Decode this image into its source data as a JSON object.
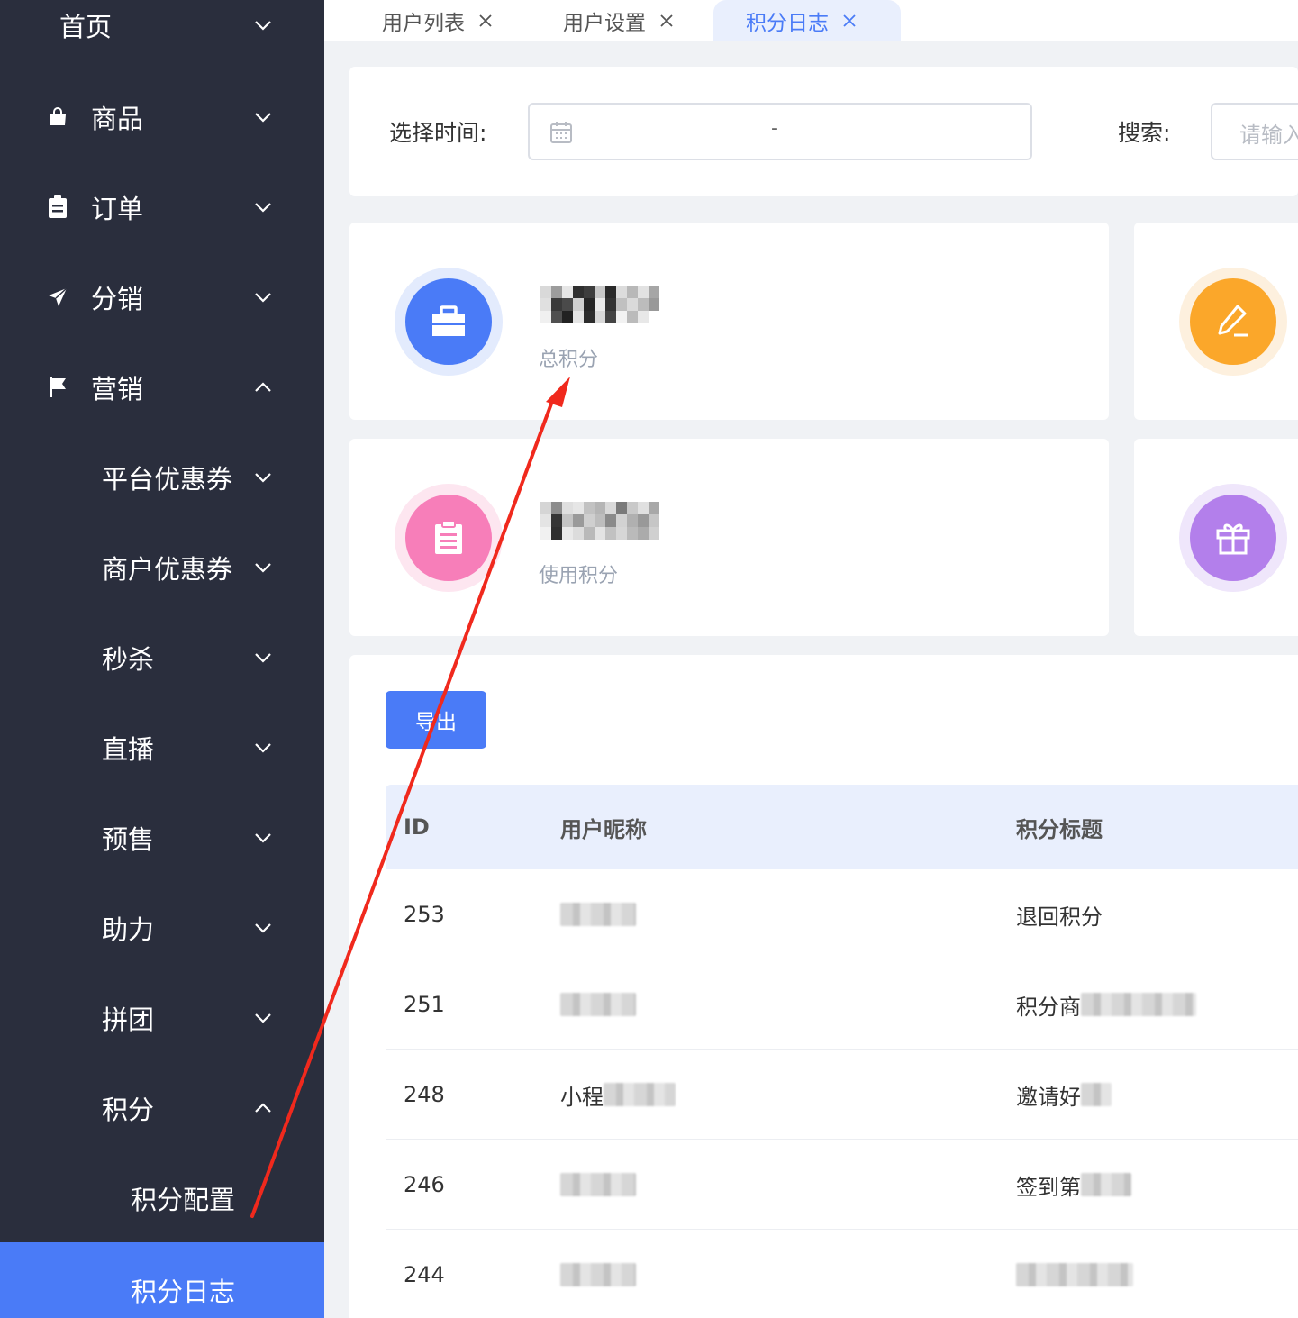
{
  "sidebar": {
    "items": [
      {
        "label": "首页",
        "icon": "none",
        "arrow": "chevron-down"
      },
      {
        "label": "商品",
        "icon": "shopping-bag-icon",
        "arrow": "chevron-down"
      },
      {
        "label": "订单",
        "icon": "clipboard-icon",
        "arrow": "chevron-down"
      },
      {
        "label": "分销",
        "icon": "paper-plane-icon",
        "arrow": "chevron-down"
      },
      {
        "label": "营销",
        "icon": "flag-icon",
        "arrow": "chevron-up"
      },
      {
        "label": "平台优惠券",
        "arrow": "chevron-down"
      },
      {
        "label": "商户优惠券",
        "arrow": "chevron-down"
      },
      {
        "label": "秒杀",
        "arrow": "chevron-down"
      },
      {
        "label": "直播",
        "arrow": "chevron-down"
      },
      {
        "label": "预售",
        "arrow": "chevron-down"
      },
      {
        "label": "助力",
        "arrow": "chevron-down"
      },
      {
        "label": "拼团",
        "arrow": "chevron-down"
      },
      {
        "label": "积分",
        "arrow": "chevron-up"
      },
      {
        "label": "积分配置"
      },
      {
        "label": "积分日志",
        "active": true
      }
    ]
  },
  "tabs": [
    {
      "label": "用户列表",
      "active": false
    },
    {
      "label": "用户设置",
      "active": false
    },
    {
      "label": "积分日志",
      "active": true
    }
  ],
  "filter": {
    "time_label": "选择时间:",
    "date_separator": "-",
    "search_label": "搜索:",
    "search_placeholder": "请输入"
  },
  "stats": [
    {
      "label": "总积分",
      "value_visible": "1517",
      "color": "#4a7bf7",
      "ring": "#e3ebfd",
      "icon": "briefcase-icon"
    },
    {
      "label": "使用积分",
      "value_visible": "15",
      "color": "#f77eb9",
      "ring": "#fde6f0",
      "icon": "clipboard-icon"
    },
    {
      "label": "",
      "color": "#fba72a",
      "ring": "#fdf0de",
      "icon": "pencil-icon"
    },
    {
      "label": "",
      "color": "#b37feb",
      "ring": "#efe6fb",
      "icon": "gift-icon"
    }
  ],
  "table": {
    "export_label": "导出",
    "columns": [
      "ID",
      "用户昵称",
      "积分标题"
    ],
    "rows": [
      {
        "id": "253",
        "nickname": "",
        "title": "退回积分"
      },
      {
        "id": "251",
        "nickname": "",
        "title": "积分商"
      },
      {
        "id": "248",
        "nickname": "小程",
        "title": "邀请好"
      },
      {
        "id": "246",
        "nickname": "",
        "title": "签到第"
      },
      {
        "id": "244",
        "nickname": "",
        "title": ""
      }
    ]
  },
  "colors": {
    "sidebar_bg": "#2a2e3d",
    "accent": "#4a7bf7",
    "annotation_arrow": "#f0291d"
  }
}
